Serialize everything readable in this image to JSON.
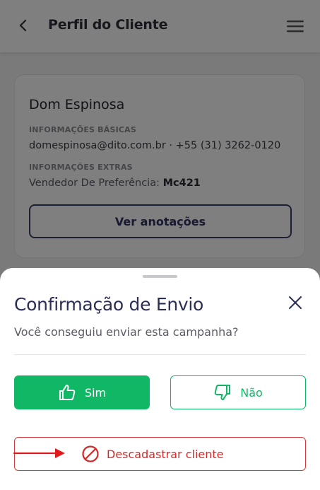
{
  "header": {
    "title": "Perfil do Cliente",
    "back_icon": "chevron-left-icon",
    "menu_icon": "hamburger-menu-icon"
  },
  "client_card": {
    "name": "Dom Espinosa",
    "basic_info_label": "INFORMAÇÕES BÁSICAS",
    "contact": "domespinosa@dito.com.br · +55 (31) 3262-0120",
    "extra_info_label": "INFORMAÇÕES EXTRAS",
    "vendor_label": "Vendedor De Preferência:",
    "vendor_value": "Mc421",
    "notes_button": "Ver anotações"
  },
  "modal": {
    "title": "Confirmação de Envio",
    "subtitle": "Você conseguiu enviar esta campanha?",
    "close_icon": "close-icon",
    "yes_label": "Sim",
    "yes_icon": "thumbs-up-icon",
    "no_label": "Não",
    "no_icon": "thumbs-down-icon",
    "unsubscribe_label": "Descadastrar cliente",
    "unsubscribe_icon": "prohibited-icon"
  },
  "colors": {
    "primary_green": "#10b765",
    "danger_red": "#d42a2a",
    "title_navy": "#2b2f55",
    "overlay": "rgba(0,0,0,0.5)"
  }
}
